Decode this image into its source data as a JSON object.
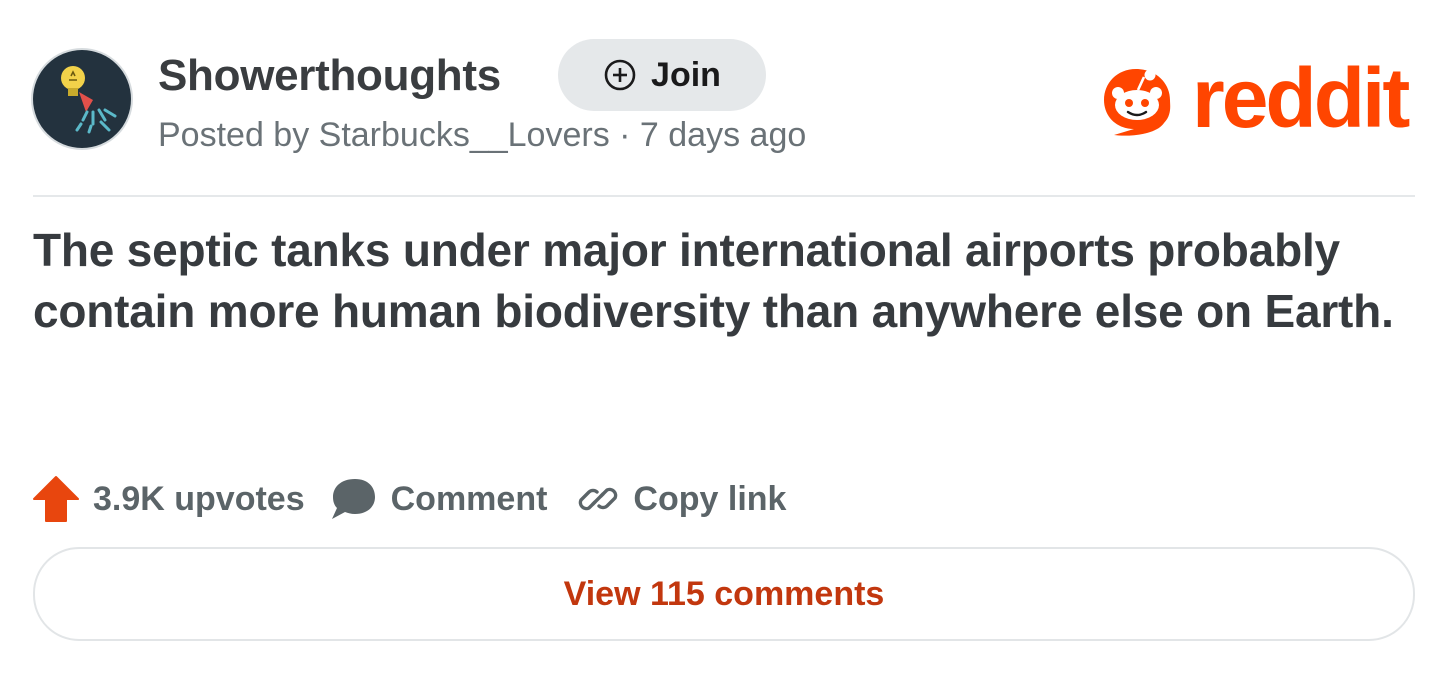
{
  "post": {
    "subreddit": "Showerthoughts",
    "join_label": "Join",
    "meta": "Posted by Starbucks__Lovers · 7 days ago",
    "brand": "reddit",
    "title": "The septic tanks under major international airports probably contain more human biodiversity than anywhere else on Earth.",
    "upvotes_label": "3.9K upvotes",
    "comment_label": "Comment",
    "copy_link_label": "Copy link",
    "view_comments_label": "View 115 comments"
  },
  "colors": {
    "brand_orange": "#ff4500",
    "upvote_orange": "#e8460e",
    "view_comments_text": "#c2370e",
    "avatar_bg": "#23323e",
    "join_bg": "#e5e8ea"
  },
  "icons": {
    "avatar": "lightbulb-shower-icon",
    "join": "plus-circle-icon",
    "logo": "reddit-snoo-icon",
    "upvote": "upvote-arrow-icon",
    "comment": "comment-bubble-icon",
    "copy_link": "link-icon"
  }
}
